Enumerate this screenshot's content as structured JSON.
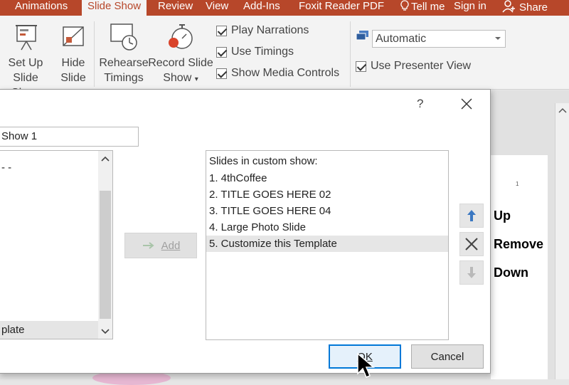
{
  "ribbon": {
    "tabs": [
      "Animations",
      "Slide Show",
      "Review",
      "View",
      "Add-Ins",
      "Foxit Reader PDF",
      "Tell me",
      "Sign in",
      "Share"
    ],
    "buttons": {
      "setup_line1": "Set Up",
      "setup_line2": "Slide Show",
      "hide_line1": "Hide",
      "hide_line2": "Slide",
      "rehearse_line1": "Rehearse",
      "rehearse_line2": "Timings",
      "record_line1": "Record Slide",
      "record_line2": "Show"
    },
    "checkboxes": [
      "Play Narrations",
      "Use Timings",
      "Show Media Controls",
      "Use Presenter View"
    ],
    "monitor_value": "Automatic"
  },
  "dialog": {
    "help": "?",
    "show_name_value": "Show 1",
    "left_list": {
      "partial_text": "- -",
      "selected_text": "plate"
    },
    "add_label": "Add",
    "right_list_header": "Slides in custom show:",
    "right_list_items": [
      "1. 4thCoffee",
      "2. TITLE GOES HERE 02",
      "3. TITLE GOES HERE 04",
      "4. Large Photo Slide",
      "5. Customize this Template"
    ],
    "ok_label": "OK",
    "cancel_label": "Cancel"
  },
  "callouts": {
    "up": "Up",
    "remove": "Remove",
    "down": "Down"
  },
  "page_marker": "1",
  "colors": {
    "accent": "#b7472a",
    "focus": "#0078d7",
    "arrow": "#3b78c2"
  }
}
